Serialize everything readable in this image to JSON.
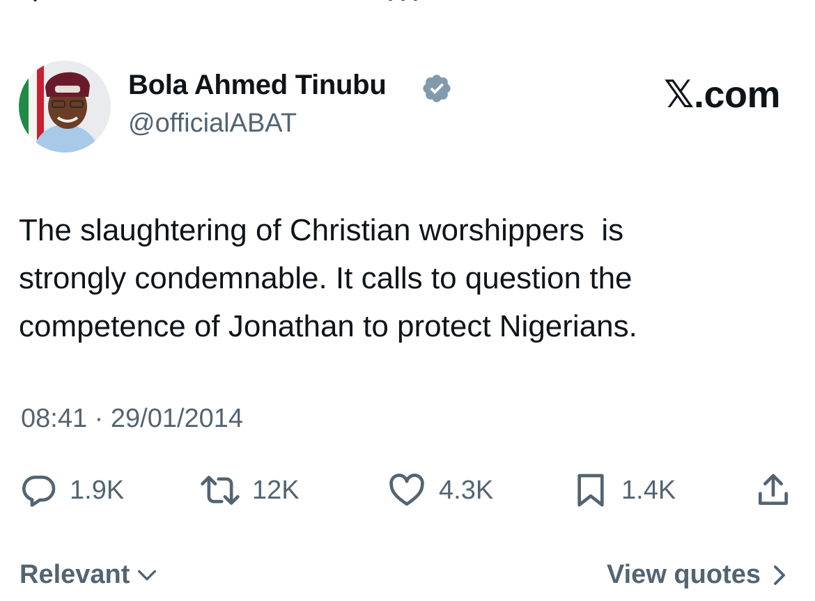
{
  "author": {
    "name": "Bola Ahmed Tinubu",
    "handle": "@officialABAT",
    "verified_color": "#829aab"
  },
  "brand": "𝕏.com",
  "tweet": {
    "text": "The slaughtering of Christian worshippers  is\nstrongly condemnable. It calls to question the\ncompetence of Jonathan to protect Nigerians.",
    "timestamp": "08:41 · 29/01/2014"
  },
  "actions": {
    "replies": "1.9K",
    "reposts": "12K",
    "likes": "4.3K",
    "bookmarks": "1.4K"
  },
  "footer": {
    "sort_label": "Relevant",
    "quotes_label": "View quotes"
  },
  "colors": {
    "text": "#0f1419",
    "secondary": "#536471"
  },
  "icons": {
    "reply": "reply-icon",
    "repost": "repost-icon",
    "like": "heart-icon",
    "bookmark": "bookmark-icon",
    "share": "share-icon",
    "verified": "verified-badge-icon"
  }
}
